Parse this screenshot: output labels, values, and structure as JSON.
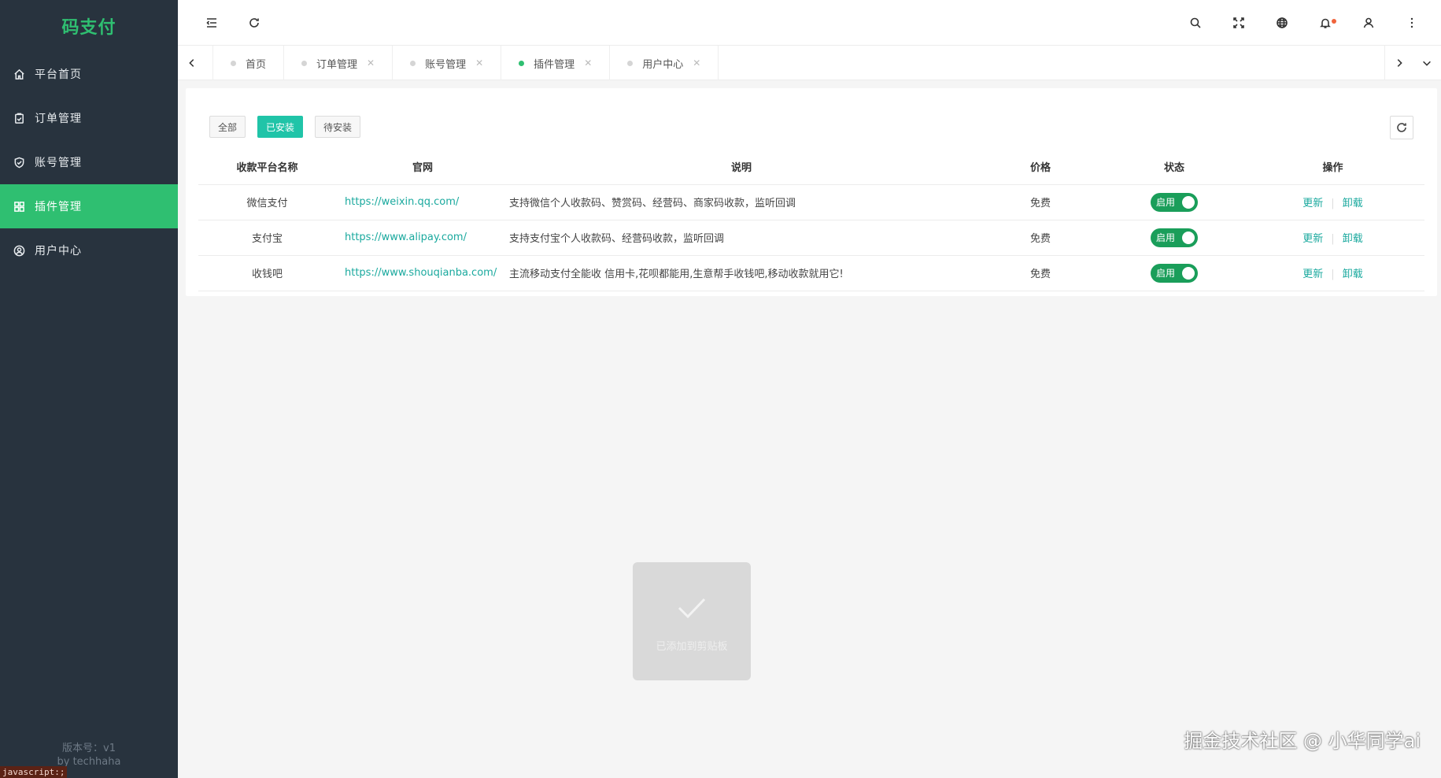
{
  "app": {
    "title": "码支付"
  },
  "sidebar": {
    "items": [
      {
        "label": "平台首页",
        "icon": "home-icon"
      },
      {
        "label": "订单管理",
        "icon": "order-icon"
      },
      {
        "label": "账号管理",
        "icon": "shield-icon"
      },
      {
        "label": "插件管理",
        "icon": "grid-icon",
        "active": true
      },
      {
        "label": "用户中心",
        "icon": "user-circle-icon"
      }
    ],
    "version": "版本号：v1",
    "author": "by techhaha",
    "js_status": "javascript:;"
  },
  "header": {
    "icons": [
      "menu-fold-icon",
      "refresh-icon",
      "search-icon",
      "fullscreen-icon",
      "globe-icon",
      "bell-icon",
      "user-icon",
      "more-icon"
    ]
  },
  "tabs": [
    {
      "label": "首页",
      "closable": false
    },
    {
      "label": "订单管理",
      "closable": true
    },
    {
      "label": "账号管理",
      "closable": true
    },
    {
      "label": "插件管理",
      "closable": true,
      "active": true
    },
    {
      "label": "用户中心",
      "closable": true
    }
  ],
  "filters": {
    "all": "全部",
    "installed": "已安装",
    "pending": "待安装",
    "active": "installed"
  },
  "table": {
    "headers": {
      "name": "收款平台名称",
      "url": "官网",
      "desc": "说明",
      "price": "价格",
      "state": "状态",
      "op": "操作"
    },
    "rows": [
      {
        "name": "微信支付",
        "url": "https://weixin.qq.com/",
        "desc": "支持微信个人收款码、赞赏码、经营码、商家码收款，监听回调",
        "price": "免费",
        "state": "启用"
      },
      {
        "name": "支付宝",
        "url": "https://www.alipay.com/",
        "desc": "支持支付宝个人收款码、经营码收款，监听回调",
        "price": "免费",
        "state": "启用"
      },
      {
        "name": "收钱吧",
        "url": "https://www.shouqianba.com/",
        "desc": "主流移动支付全能收 信用卡,花呗都能用,生意帮手收钱吧,移动收款就用它!",
        "price": "免费",
        "state": "启用"
      }
    ],
    "ops": {
      "update": "更新",
      "uninstall": "卸载"
    }
  },
  "toast": {
    "text": "已添加到剪贴板"
  },
  "watermark": "掘金技术社区 @ 小华同学ai",
  "colors": {
    "accent": "#2fbf71",
    "teal": "#20c4a8",
    "sidebar_bg": "#28333e",
    "switch_on": "#1a9e5a"
  }
}
